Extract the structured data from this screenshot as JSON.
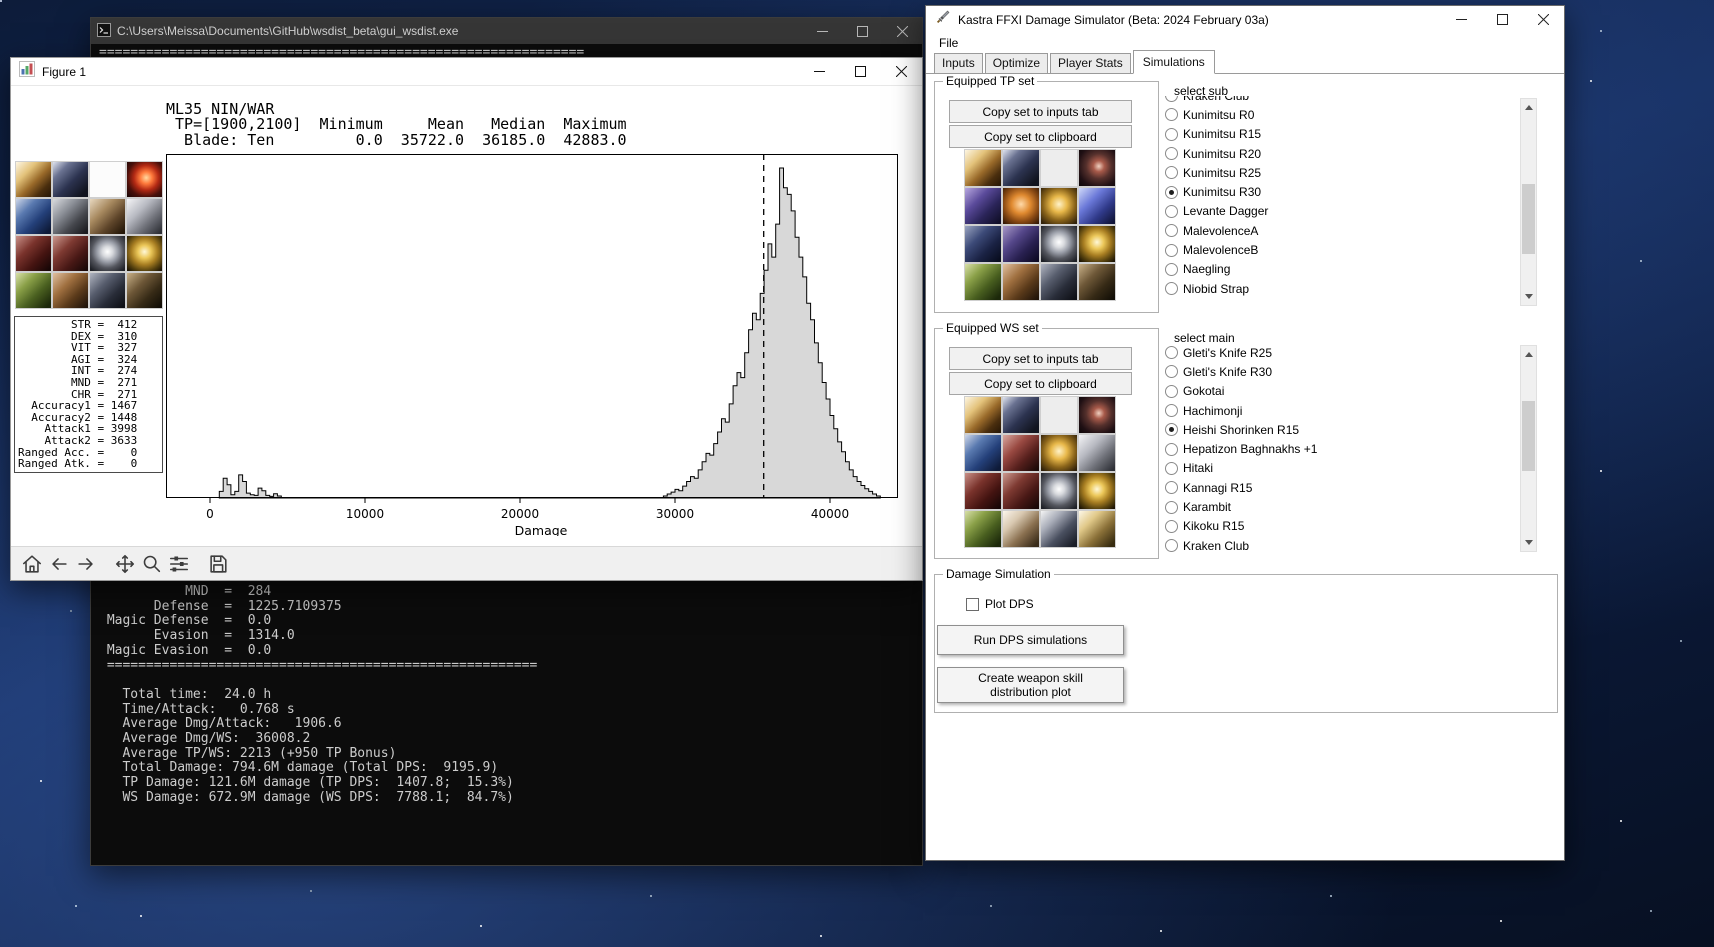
{
  "console": {
    "title": "C:\\Users\\Meissa\\Documents\\GitHub\\wsdist_beta\\gui_wsdist.exe",
    "top_separator": "==============================================================",
    "output_lines": [
      "           MND  =  284",
      "       Defense  =  1225.7109375",
      " Magic Defense  =  0.0",
      "       Evasion  =  1314.0",
      " Magic Evasion  =  0.0",
      " =======================================================",
      "",
      "   Total time:  24.0 h",
      "   Time/Attack:   0.768 s",
      "   Average Dmg/Attack:   1906.6",
      "   Average Dmg/WS:  36008.2",
      "   Average TP/WS: 2213 (+950 TP Bonus)",
      "   Total Damage: 794.6M damage (Total DPS:  9195.9)",
      "   TP Damage: 121.6M damage (TP DPS:  1407.8;  15.3%)",
      "   WS Damage: 672.9M damage (WS DPS:  7788.1;  84.7%)"
    ]
  },
  "figure": {
    "title": "Figure 1",
    "summary_lines": [
      "ML35 NIN/WAR",
      " TP=[1900,2100]  Minimum     Mean   Median  Maximum",
      "  Blade: Ten         0.0  35722.0  36185.0  42883.0"
    ],
    "stats_lines": [
      "        STR =  412",
      "        DEX =  310",
      "        VIT =  327",
      "        AGI =  324",
      "        INT =  274",
      "        MND =  271",
      "        CHR =  271",
      "  Accuracy1 = 1467",
      "  Accuracy2 = 1448",
      "    Attack1 = 3998",
      "    Attack2 = 3633",
      "Ranged Acc. =    0",
      "Ranged Atk. =    0"
    ],
    "gear_slots": [
      "weapon-dagger",
      "weapon-blade",
      "empty-slot",
      "ammo-flame",
      "head-armor",
      "neck-collar",
      "earring-brown",
      "earring-silver",
      "body-armor",
      "hands-gloves",
      "ring-silver",
      "ring-gold",
      "back-cape",
      "waist-belt",
      "legs-armor",
      "feet-boots"
    ],
    "toolbar_icons": [
      "home",
      "back",
      "forward",
      "pan",
      "zoom",
      "configure-subplots",
      "save"
    ]
  },
  "chart_data": {
    "type": "histogram",
    "title": "",
    "xlabel": "Damage",
    "ylabel": "",
    "x_ticks": [
      0,
      10000,
      20000,
      30000,
      40000
    ],
    "xlim": [
      -2840,
      44390
    ],
    "bin_width": 250,
    "mean_line": 35722,
    "grid": false,
    "bins_unit": "relative_height_percent",
    "summary_stats": {
      "player": "ML35 NIN/WAR",
      "tp_window": "[1900,2100]",
      "weapon_skill": "Blade: Ten",
      "minimum": 0.0,
      "mean": 35722.0,
      "median": 36185.0,
      "maximum": 42883.0
    },
    "bins": [
      [
        600,
        2
      ],
      [
        850,
        6
      ],
      [
        1100,
        4
      ],
      [
        1350,
        1
      ],
      [
        1600,
        2
      ],
      [
        1850,
        7
      ],
      [
        2100,
        5
      ],
      [
        2350,
        1.5
      ],
      [
        2600,
        1
      ],
      [
        2850,
        0.8
      ],
      [
        3100,
        3
      ],
      [
        3350,
        2.2
      ],
      [
        3600,
        0.8
      ],
      [
        3850,
        0.5
      ],
      [
        4100,
        1.3
      ],
      [
        4350,
        0.6
      ],
      [
        29250,
        0.6
      ],
      [
        29500,
        1.2
      ],
      [
        29750,
        1.8
      ],
      [
        30000,
        2.6
      ],
      [
        30250,
        2.2
      ],
      [
        30500,
        3.6
      ],
      [
        30750,
        5
      ],
      [
        31000,
        6.5
      ],
      [
        31250,
        6
      ],
      [
        31500,
        8.5
      ],
      [
        31750,
        11
      ],
      [
        32000,
        13.5
      ],
      [
        32250,
        13
      ],
      [
        32500,
        16.5
      ],
      [
        32750,
        20
      ],
      [
        33000,
        24
      ],
      [
        33250,
        23
      ],
      [
        33500,
        28.5
      ],
      [
        33750,
        34
      ],
      [
        34000,
        38
      ],
      [
        34250,
        36.5
      ],
      [
        34500,
        44
      ],
      [
        34750,
        51
      ],
      [
        35000,
        56
      ],
      [
        35250,
        54
      ],
      [
        35500,
        62
      ],
      [
        35750,
        69
      ],
      [
        36000,
        77
      ],
      [
        36250,
        73
      ],
      [
        36500,
        83
      ],
      [
        36750,
        100
      ],
      [
        37000,
        94
      ],
      [
        37250,
        92
      ],
      [
        37500,
        87
      ],
      [
        37750,
        79
      ],
      [
        38000,
        73
      ],
      [
        38250,
        67
      ],
      [
        38500,
        59
      ],
      [
        38750,
        54
      ],
      [
        39000,
        47
      ],
      [
        39250,
        41
      ],
      [
        39500,
        35
      ],
      [
        39750,
        30
      ],
      [
        40000,
        25
      ],
      [
        40250,
        21
      ],
      [
        40500,
        17
      ],
      [
        40750,
        14
      ],
      [
        41000,
        11
      ],
      [
        41250,
        8.5
      ],
      [
        41500,
        6.5
      ],
      [
        41750,
        5
      ],
      [
        42000,
        3.8
      ],
      [
        42250,
        2.8
      ],
      [
        42500,
        2
      ],
      [
        42750,
        1.2
      ],
      [
        43000,
        0.6
      ]
    ]
  },
  "app": {
    "title": "Kastra FFXI Damage Simulator (Beta: 2024 February 03a)",
    "menu": [
      "File"
    ],
    "tabs": [
      "Inputs",
      "Optimize",
      "Player Stats",
      "Simulations"
    ],
    "active_tab": "Simulations",
    "tp_set": {
      "label": "Equipped TP set",
      "copy_to_inputs": "Copy set to inputs tab",
      "copy_to_clipboard": "Copy set to clipboard",
      "slots": [
        "weapon-dagger",
        "weapon-blade",
        "empty-slot-gray",
        "ammo-dark",
        "head-jeweled",
        "neck-amber",
        "earring-gold",
        "earring-gem",
        "body-dark",
        "hands-dark",
        "ring-silver",
        "ring-gold",
        "back-cape",
        "waist-belt",
        "legs-armor",
        "feet-boots"
      ]
    },
    "ws_set": {
      "label": "Equipped WS set",
      "copy_to_inputs": "Copy set to inputs tab",
      "copy_to_clipboard": "Copy set to clipboard",
      "slots": [
        "weapon-dagger",
        "weapon-blade",
        "empty-slot-gray",
        "ammo-dark",
        "head-armor",
        "neck-red",
        "earring-gold",
        "earring-silver",
        "body-armor",
        "hands-gloves",
        "ring-silver",
        "ring-gold",
        "back-cape",
        "waist-light",
        "legs-white",
        "feet-gold"
      ]
    },
    "select_sub": {
      "label": "select sub",
      "options": [
        "Kraken Club",
        "Kunimitsu R0",
        "Kunimitsu R15",
        "Kunimitsu R20",
        "Kunimitsu R25",
        "Kunimitsu R30",
        "Levante Dagger",
        "MalevolenceA",
        "MalevolenceB",
        "Naegling",
        "Niobid Strap"
      ],
      "selected": "Kunimitsu R30"
    },
    "select_main": {
      "label": "select main",
      "options": [
        "Gleti's Knife R25",
        "Gleti's Knife R30",
        "Gokotai",
        "Hachimonji",
        "Heishi Shorinken R15",
        "Hepatizon Baghnakhs +1",
        "Hitaki",
        "Kannagi R15",
        "Karambit",
        "Kikoku R15",
        "Kraken Club"
      ],
      "selected": "Heishi Shorinken R15"
    },
    "damage_sim": {
      "label": "Damage Simulation",
      "plot_dps_label": "Plot DPS",
      "plot_dps_checked": false,
      "run_label": "Run DPS simulations",
      "create_lines": [
        "Create weapon skill",
        "distribution plot"
      ]
    }
  }
}
